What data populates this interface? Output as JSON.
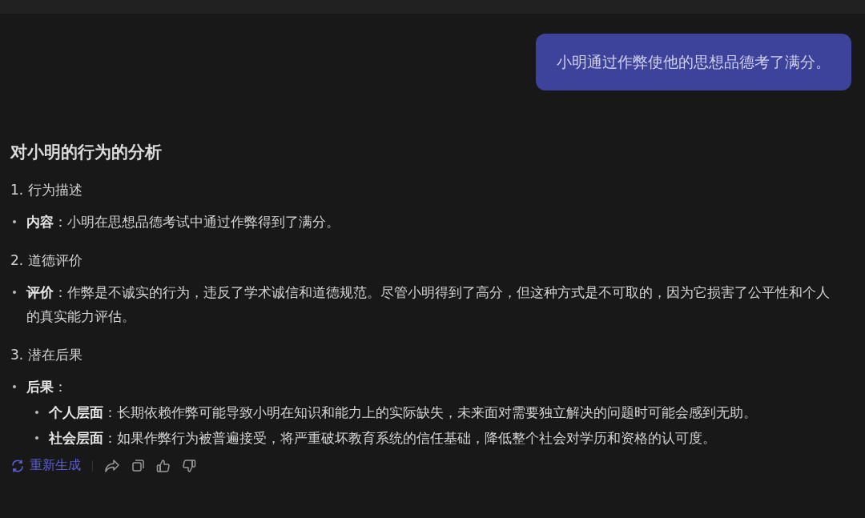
{
  "user_message": "小明通过作弊使他的思想品德考了满分。",
  "answer": {
    "title": "对小明的行为的分析",
    "sections": [
      {
        "heading": "1. 行为描述",
        "items": [
          {
            "text": "**内容**：小明在思想品德考试中通过作弊得到了满分。"
          }
        ]
      },
      {
        "heading": "2. 道德评价",
        "items": [
          {
            "text": "**评价**：作弊是不诚实的行为，违反了学术诚信和道德规范。尽管小明得到了高分，但这种方式是不可取的，因为它损害了公平性和个人的真实能力评估。"
          }
        ]
      },
      {
        "heading": "3. 潜在后果",
        "items": [
          {
            "text": "**后果**：",
            "children": [
              {
                "text": "**个人层面**：长期依赖作弊可能导致小明在知识和能力上的实际缺失，未来面对需要独立解决的问题时可能会感到无助。"
              },
              {
                "text": "**社会层面**：如果作弊行为被普遍接受，将严重破坏教育系统的信任基础，降低整个社会对学历和资格的认可度。"
              }
            ]
          }
        ]
      }
    ]
  },
  "actions": {
    "regenerate": "重新生成"
  }
}
